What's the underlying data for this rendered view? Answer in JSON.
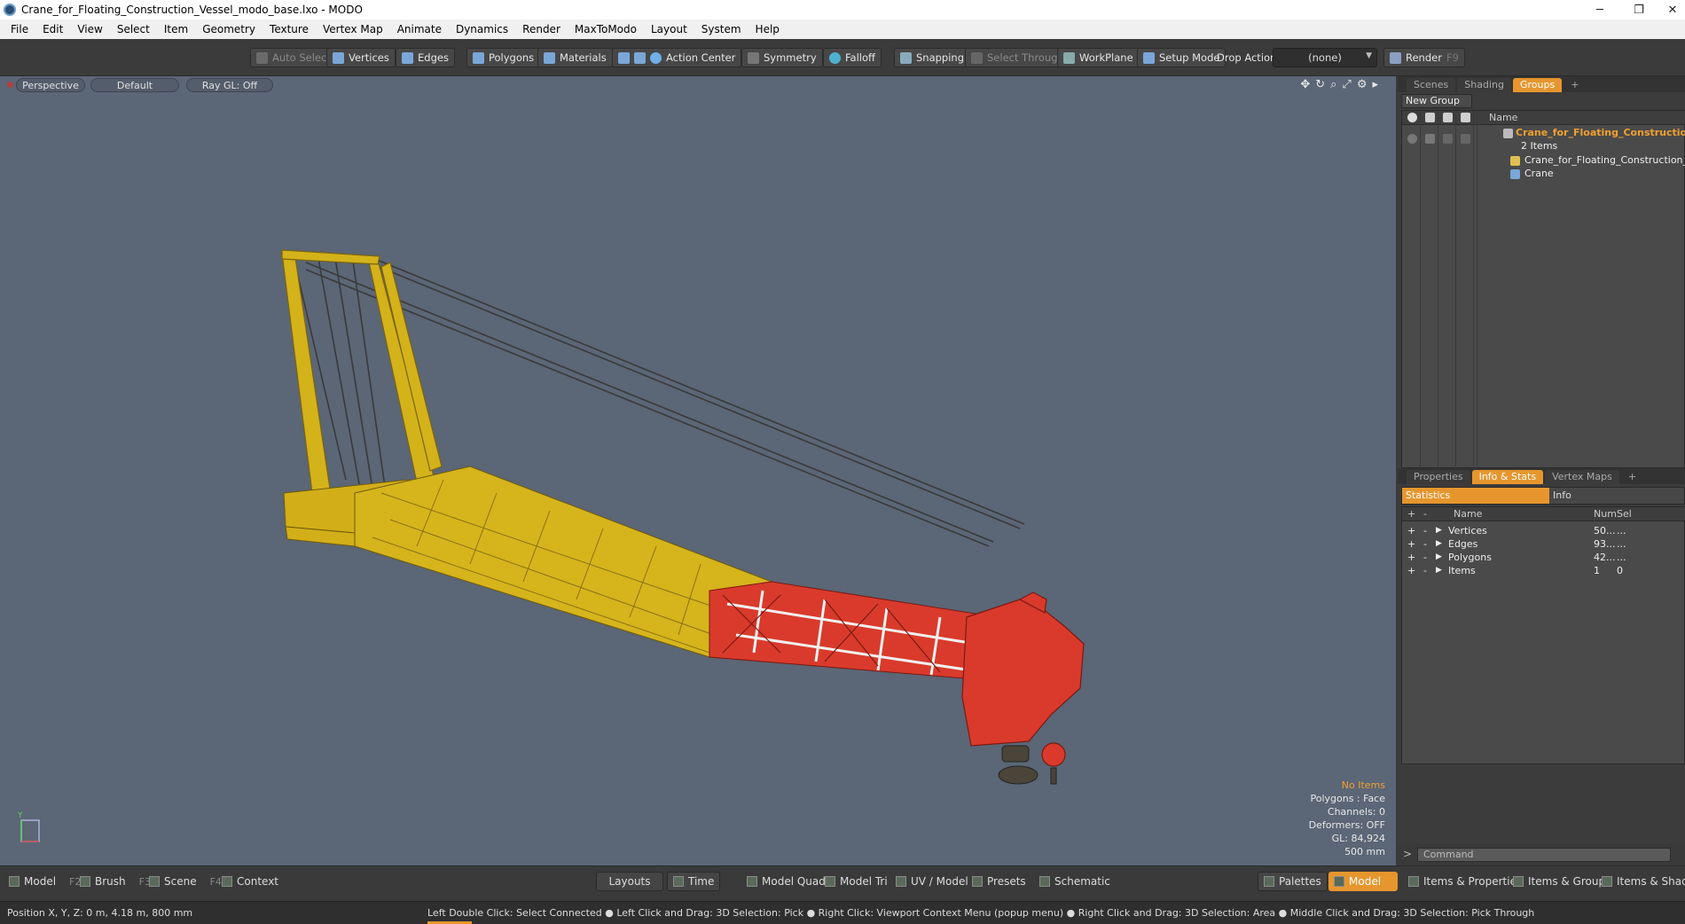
{
  "window": {
    "title": "Crane_for_Floating_Construction_Vessel_modo_base.lxo - MODO",
    "min_glyph": "─",
    "restore_glyph": "❐",
    "close_glyph": "✕"
  },
  "menu": [
    "File",
    "Edit",
    "View",
    "Select",
    "Item",
    "Geometry",
    "Texture",
    "Vertex Map",
    "Animate",
    "Dynamics",
    "Render",
    "MaxToModo",
    "Layout",
    "System",
    "Help"
  ],
  "toolbar": {
    "auto_select": "Auto Select",
    "vertices": "Vertices",
    "edges": "Edges",
    "polygons": "Polygons",
    "materials": "Materials",
    "action_center": "Action Center",
    "symmetry": "Symmetry",
    "falloff": "Falloff",
    "snapping": "Snapping",
    "select_through": "Select Through",
    "workplane": "WorkPlane",
    "setup_mode": "Setup Mode",
    "drop_action_label": "Drop Action",
    "drop_action_value": "(none)",
    "render": "Render",
    "render_key": "F9"
  },
  "viewport": {
    "view": "Perspective",
    "shading": "Default",
    "raygl": "Ray GL: Off",
    "stats": {
      "items": "No Items",
      "polygons": "Polygons : Face",
      "channels": "Channels: 0",
      "deformers": "Deformers: OFF",
      "gl": "GL: 84,924",
      "scale": "500 mm"
    },
    "axis_label": "Y"
  },
  "groups_panel": {
    "tabs": [
      "Scenes",
      "Shading",
      "Groups"
    ],
    "active_tab": "Groups",
    "new_group": "New Group",
    "col_name": "Name",
    "group_name": "Crane_for_Floating_Constructio...",
    "group_count": "2 Items",
    "children": [
      "Crane_for_Floating_Construction_...",
      "Crane"
    ]
  },
  "info_panel": {
    "tabs": [
      "Properties",
      "Info & Stats",
      "Vertex Maps"
    ],
    "active_tab": "Info & Stats",
    "statistics": "Statistics",
    "info": "Info",
    "col_name": "Name",
    "col_num": "Num",
    "col_sel": "Sel",
    "rows": [
      {
        "name": "Vertices",
        "num": "50...",
        "sel": "..."
      },
      {
        "name": "Edges",
        "num": "93...",
        "sel": "..."
      },
      {
        "name": "Polygons",
        "num": "42...",
        "sel": "..."
      },
      {
        "name": "Items",
        "num": "1",
        "sel": "0"
      }
    ],
    "command_placeholder": "Command"
  },
  "bottom": {
    "model": "Model",
    "model_key": "F2",
    "brush": "Brush",
    "brush_key": "F3",
    "scene": "Scene",
    "scene_key": "F4",
    "context": "Context",
    "layouts": "Layouts",
    "time": "Time",
    "model_quad": "Model Quad",
    "model_tri": "Model Tri",
    "uv_model": "UV / Model",
    "presets": "Presets",
    "schematic": "Schematic",
    "palettes": "Palettes",
    "model_active": "Model",
    "items_properties": "Items & Properties",
    "items_groups": "Items & Groups",
    "items_shading": "Items & Shadin"
  },
  "status": {
    "position": "Position X, Y, Z:   0 m, 4.18 m, 800 mm",
    "hint": "Left Double Click: Select Connected ● Left Click and Drag: 3D Selection: Pick ● Right Click: Viewport Context Menu (popup menu) ● Right Click and Drag: 3D Selection: Area ● Middle Click and Drag: 3D Selection: Pick Through"
  },
  "colors": {
    "accent": "#e6962d",
    "viewport_bg": "#5b6676",
    "crane_yellow": "#d4b21a",
    "crane_red": "#d93a2b"
  }
}
